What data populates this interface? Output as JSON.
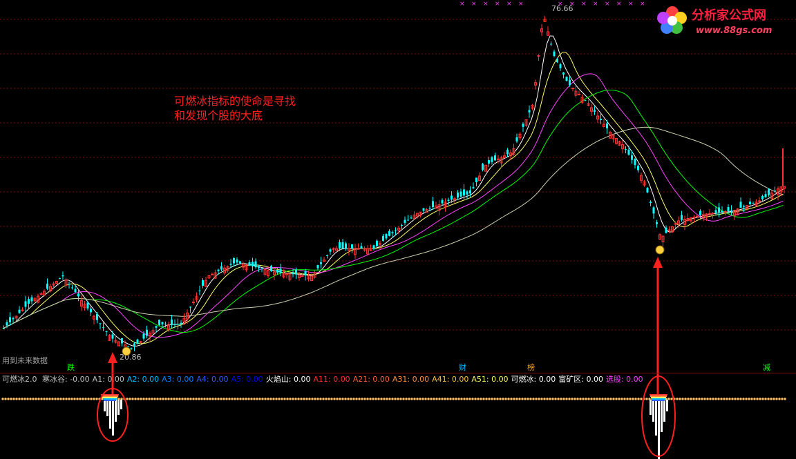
{
  "chart_data": {
    "type": "candlestick",
    "price_labels": {
      "high": "76.66",
      "low": "20.86"
    },
    "annotation": {
      "line1": "可燃冰指标的使命是寻找",
      "line2": "和发现个股的大底"
    },
    "future_data_label": "用到未来数据",
    "tags": [
      "跌",
      "财",
      "榜",
      "减"
    ],
    "colors": {
      "up": "#ff3232",
      "down": "#00ffff",
      "ma5": "#ffffff",
      "ma10": "#ffff66",
      "ma20": "#ff44ff",
      "ma30": "#00ff00",
      "ma60": "#d0d0b0"
    }
  },
  "indicator": {
    "name": "可燃冰2.0",
    "items": [
      {
        "label": "寒冰谷: -0.00",
        "color": "#c0c0c0"
      },
      {
        "label": "A1: 0.00",
        "color": "#c0c0c0"
      },
      {
        "label": "A2: 0.00",
        "color": "#00c0ff"
      },
      {
        "label": "A3: 0.00",
        "color": "#0080ff"
      },
      {
        "label": "A4: 0.00",
        "color": "#3060ff"
      },
      {
        "label": "A5: 0.00",
        "color": "#0000ff"
      },
      {
        "label": "火焰山: 0.00",
        "color": "#ffffff"
      },
      {
        "label": "A11: 0.00",
        "color": "#ff3030"
      },
      {
        "label": "A21: 0.00",
        "color": "#ff6040"
      },
      {
        "label": "A31: 0.00",
        "color": "#ff9040"
      },
      {
        "label": "A41: 0.00",
        "color": "#ffc040"
      },
      {
        "label": "A51: 0.00",
        "color": "#ffff60"
      },
      {
        "label": "可燃冰: 0.00",
        "color": "#ffffff"
      },
      {
        "label": "富矿区: 0.00",
        "color": "#ffffff"
      },
      {
        "label": "选股: 0.00",
        "color": "#ff40ff"
      }
    ]
  },
  "watermark": {
    "title": "分析家公式网",
    "url": "www.88gs.com"
  }
}
